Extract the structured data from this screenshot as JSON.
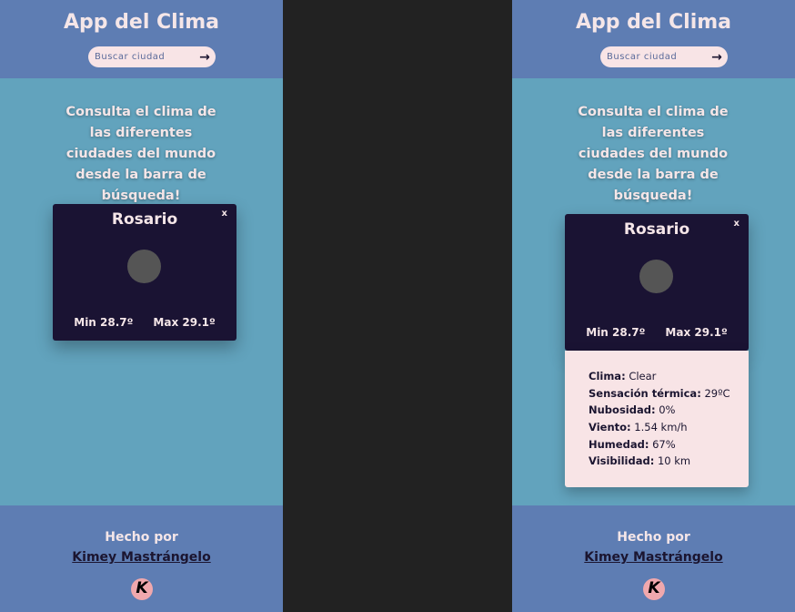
{
  "app": {
    "title": "App del Clima",
    "search_placeholder": "Buscar ciudad",
    "search_button_icon": "arrow-right-icon",
    "intro": "Consulta el clima de las diferentes ciudades del mundo desde la barra de búsqueda!",
    "footer_made_by": "Hecho por",
    "footer_author": "Kimey Mastrángelo",
    "footer_logo_letter": "K"
  },
  "card": {
    "city": "Rosario",
    "close": "x",
    "icon": "weather-icon",
    "min": "Min 28.7º",
    "max": "Max 29.1º"
  },
  "details": [
    {
      "label": "Clima:",
      "value": "Clear"
    },
    {
      "label": "Sensación térmica:",
      "value": "29ºC"
    },
    {
      "label": "Nubosidad:",
      "value": "0%"
    },
    {
      "label": "Viento:",
      "value": "1.54 km/h"
    },
    {
      "label": "Humedad:",
      "value": "67%"
    },
    {
      "label": "Visibilidad:",
      "value": "10 km"
    }
  ],
  "colors": {
    "header": "#5e7db3",
    "main": "#62a3bd",
    "card": "#1a1333",
    "details": "#f8e4e6",
    "divider": "#222222"
  }
}
